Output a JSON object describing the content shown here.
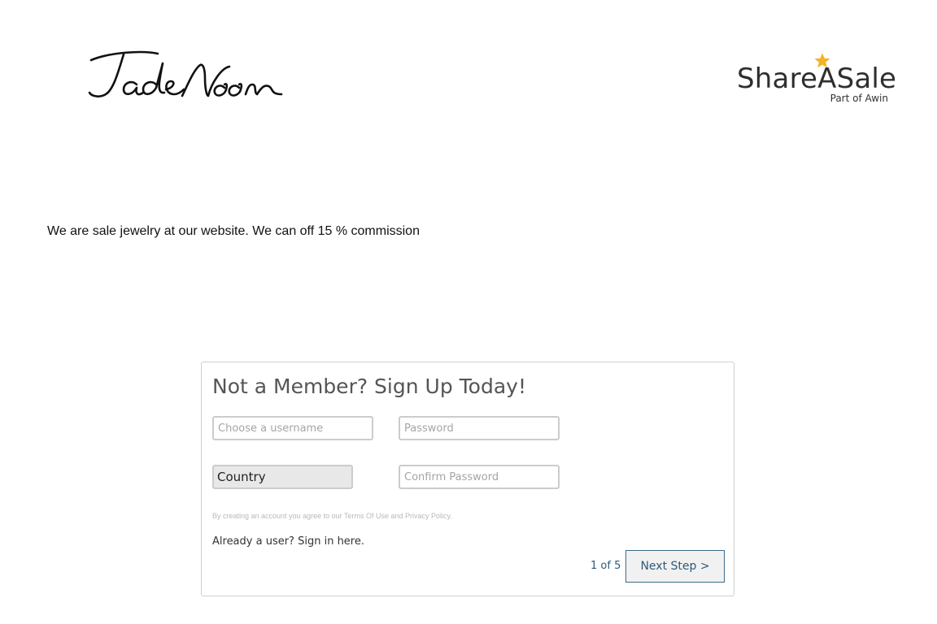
{
  "header": {
    "brand_logo_alt": "JadeMoon",
    "partner": {
      "wordmark": "ShareASale",
      "subline": "Part of Awin",
      "star_color": "#f5b324"
    }
  },
  "merchant": {
    "description": "We are sale jewelry at our website. We can off 15 % commission"
  },
  "signup": {
    "title": "Not a Member? Sign Up Today!",
    "username_placeholder": "Choose a username",
    "password_placeholder": "Password",
    "country_value": "Country",
    "confirm_password_placeholder": "Confirm Password",
    "legal_prefix": "By creating an account you agree to our ",
    "terms_link": "Terms Of Use",
    "legal_and": " and ",
    "privacy_link": "Privacy Policy",
    "legal_suffix": ".",
    "signin_text": "Already a user? Sign in here.",
    "step_indicator": "1 of 5",
    "next_button": "Next Step >"
  }
}
